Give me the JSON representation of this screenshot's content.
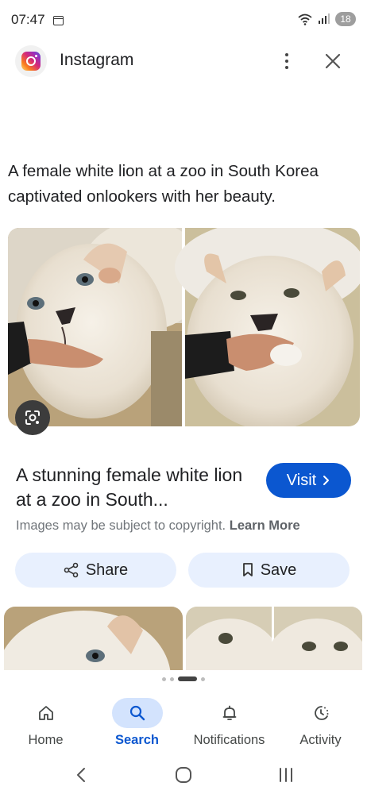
{
  "status_bar": {
    "time": "07:47",
    "battery": "18",
    "icons": [
      "calendar-icon",
      "wifi-icon",
      "signal-icon",
      "battery-icon"
    ]
  },
  "header": {
    "app_name": "Instagram",
    "app_icon": "instagram-logo",
    "more_icon": "more-vert-icon",
    "close_icon": "close-icon"
  },
  "caption": "A female white lion at a zoo in South Korea captivated onlookers with her beauty.",
  "result": {
    "title": "A stunning female white lion at a zoo in South...",
    "visit_label": "Visit",
    "copyright_text": "Images may be subject to copyright.",
    "learn_more": "Learn More",
    "share_label": "Share",
    "save_label": "Save",
    "lens_icon": "lens-icon"
  },
  "bottom_nav": {
    "items": [
      {
        "label": "Home",
        "icon": "home-icon",
        "active": false
      },
      {
        "label": "Search",
        "icon": "search-icon",
        "active": true
      },
      {
        "label": "Notifications",
        "icon": "bell-icon",
        "active": false
      },
      {
        "label": "Activity",
        "icon": "activity-icon",
        "active": false
      }
    ]
  },
  "colors": {
    "accent": "#0b57d0",
    "pill_bg": "#e8f0fe",
    "nav_active_bg": "#d3e3fd"
  }
}
